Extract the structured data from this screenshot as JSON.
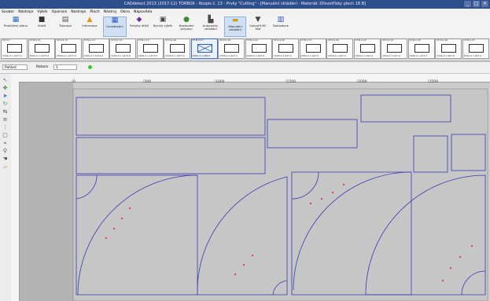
{
  "window": {
    "title": "CADdetect 2013 (2017-12) TORBOX - Rozpis č. 13 - Prvky \"Cutting\" - [Manuální skládání - Materiál: Dřevotřísky plech 18 B]",
    "minimize": "_",
    "maximize": "□",
    "close": "×"
  },
  "menu": [
    "Soubor",
    "Nástroje",
    "Výběr",
    "Operace",
    "Nastroje",
    "Plach",
    "Nástroj",
    "Okno",
    "Nápověda"
  ],
  "ribbon": [
    {
      "label": "Prohlížení plánu",
      "icon": "preview-icon"
    },
    {
      "label": "Uložit",
      "icon": "save-icon"
    },
    {
      "label": "Tisknout",
      "icon": "print-icon"
    },
    {
      "label": "Informace",
      "icon": "info-icon"
    },
    {
      "label": "Umisťování",
      "icon": "grid-icon"
    },
    {
      "label": "Pohyby dílků",
      "icon": "move-parts-icon"
    },
    {
      "label": "Rychlý výběr",
      "icon": "quick-select-icon"
    },
    {
      "label": "Nastavení procesu",
      "icon": "settings-icon"
    },
    {
      "label": "Automatic. skládání",
      "icon": "auto-nest-icon"
    },
    {
      "label": "Manuální skládání",
      "icon": "manual-nest-icon"
    },
    {
      "label": "Vytvořit NC kód",
      "icon": "nc-code-icon"
    },
    {
      "label": "Dokladace",
      "icon": "document-icon"
    }
  ],
  "sheets": [
    {
      "id": "ST.N.1",
      "size": "1500.0 x 1477.0"
    },
    {
      "id": "ST.N.2.11",
      "size": "1500.0 x 1477.0"
    },
    {
      "id": "ST.N.2.12",
      "size": "1500.0 x 1477.0"
    },
    {
      "id": "ST.N.2.13",
      "size": "1500.0 x 1474.0"
    },
    {
      "id": "ST.N.2.14",
      "size": "1500.0 x 1474.0"
    },
    {
      "id": "ST.N.2.15",
      "size": "1500.0 x 1477.0"
    },
    {
      "id": "ST.N.2.16",
      "size": "1500.0 x 1477.0"
    },
    {
      "id": "ST.N.2.17",
      "size": "1884.4 x 280.0"
    },
    {
      "id": "ST.N.2.18",
      "size": "1500.0 x 927.0"
    },
    {
      "id": "ST.N.2.19",
      "size": "1500.0 x 927.0"
    },
    {
      "id": "ST.N.2.20",
      "size": "1500.0 x 927.0"
    },
    {
      "id": "ST.N.2.21",
      "size": "1500.0 x 927.0"
    },
    {
      "id": "ST.N.2.22",
      "size": "1500.0 x 927.0"
    },
    {
      "id": "ST.N.2.23",
      "size": "1500.0 x 927.0"
    },
    {
      "id": "ST.N.2.24",
      "size": "1500.0 x 927.0"
    },
    {
      "id": "ST.N.2.25",
      "size": "1500.0 x 927.0"
    },
    {
      "id": "ST.N.2.26",
      "size": "1500.0 x 927.0"
    },
    {
      "id": "ST.N.2.27",
      "size": "1500.0 x 927.0"
    }
  ],
  "selected_sheet_index": 7,
  "options": {
    "mode_value": "Pohled",
    "rotation_label": "Rotace",
    "rotation_value": "1",
    "status_color": "#33cc33"
  },
  "ruler": {
    "ticks": [
      "0",
      "500",
      "1000",
      "1500",
      "2000",
      "2500"
    ]
  },
  "colors": {
    "outline": "#3a3ab0",
    "marker": "#e04070",
    "canvas": "#cbcbcb",
    "sheet": "#c6c6c6"
  }
}
